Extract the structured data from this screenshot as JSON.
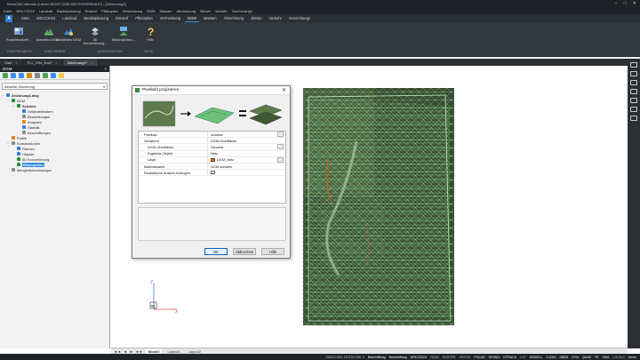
{
  "window": {
    "title": "BricsCAD Ultimate (Lizenz NICHT ZUM WEITERVERKAUF) - [Zeichnung1]",
    "controls": [
      "–",
      "□",
      "✕"
    ]
  },
  "menu": [
    "Datei",
    "WSLC2024",
    "Landcad",
    "Bauleitplanung",
    "Entwurf",
    "Pflanzplan",
    "Vermessung",
    "DGM",
    "Massen",
    "Abrechnung",
    "3Drain",
    "Verkehr",
    "GeoXchange"
  ],
  "ribbon": {
    "logo": "A",
    "tabs": [
      {
        "label": "Start",
        "active": false
      },
      {
        "label": "WSLC2024",
        "active": false
      },
      {
        "label": "Landcad",
        "active": false
      },
      {
        "label": "Bauleitplanung",
        "active": false
      },
      {
        "label": "Entwurf",
        "active": false
      },
      {
        "label": "Pflanzplan",
        "active": false
      },
      {
        "label": "Vermessung",
        "active": false
      },
      {
        "label": "DGM",
        "active": true
      },
      {
        "label": "Massen",
        "active": false
      },
      {
        "label": "Abrechnung",
        "active": false
      },
      {
        "label": "3Drain",
        "active": false
      },
      {
        "label": "Verkehr",
        "active": false
      },
      {
        "label": "GeoXchange",
        "active": false
      }
    ],
    "buttons": [
      {
        "label": "Projektexplorer..."
      },
      {
        "label": "Aktuelles DGM..."
      },
      {
        "label": "Gewähltes DGM"
      },
      {
        "label": "3D Konvertierung..."
      },
      {
        "label": "Bildprojektion..."
      },
      {
        "label": "Hilfe"
      }
    ],
    "groups": [
      "DGM-PROJEKTE",
      "DGM-VIEWER",
      "KONSTRUKTION",
      "HILFE"
    ]
  },
  "doc_tabs": [
    {
      "label": "Start",
      "active": false
    },
    {
      "label": "FLL_DIM_final*",
      "active": false
    },
    {
      "label": "Zeichnung1*",
      "active": true
    }
  ],
  "panel": {
    "title": "DGM",
    "select_value": "Aktuelle Zeichnung",
    "tree": [
      {
        "level": 0,
        "label": "Zeichnung1.dwg",
        "bold": true,
        "expand": "−",
        "icon": "#3a7bd5"
      },
      {
        "level": 1,
        "label": "DGM",
        "bold": false,
        "expand": "−",
        "icon": "#2b8a3e"
      },
      {
        "level": 2,
        "label": "Schweiz",
        "bold": true,
        "expand": "−",
        "icon": "#2b8a3e"
      },
      {
        "level": 3,
        "label": "Geländefenstern",
        "bold": false,
        "expand": "",
        "icon": "#3a7bd5"
      },
      {
        "level": 3,
        "label": "Bearbeitungen",
        "bold": false,
        "expand": "",
        "icon": "#888888"
      },
      {
        "level": 3,
        "label": "Analysen",
        "bold": false,
        "expand": "",
        "icon": "#d18b1a"
      },
      {
        "level": 3,
        "label": "Statistik",
        "bold": false,
        "expand": "",
        "icon": "#3a7bd5"
      },
      {
        "level": 3,
        "label": "Beschriftungen",
        "bold": false,
        "expand": "",
        "icon": "#888888"
      },
      {
        "level": 1,
        "label": "Profile",
        "bold": false,
        "expand": "",
        "icon": "#d18b1a"
      },
      {
        "level": 1,
        "label": "Konstruktionen",
        "bold": false,
        "expand": "−",
        "icon": "#888888"
      },
      {
        "level": 2,
        "label": "Flächen",
        "bold": false,
        "expand": "",
        "icon": "#3a7bd5"
      },
      {
        "level": 2,
        "label": "Objekte",
        "bold": false,
        "expand": "",
        "icon": "#3a7bd5"
      },
      {
        "level": 2,
        "label": "3D Konvertierung",
        "bold": false,
        "expand": "",
        "icon": "#2b8a3e"
      },
      {
        "level": 2,
        "label": "Bildprojektion",
        "bold": false,
        "expand": "",
        "icon": "#2b8a3e",
        "selected": true
      },
      {
        "level": 1,
        "label": "Mengenberechnungen",
        "bold": false,
        "expand": "",
        "icon": "#888888"
      }
    ]
  },
  "dialog": {
    "title": "Pixelbild projizieren",
    "close": "✕",
    "properties": [
      {
        "key": "Pixelbild",
        "value": "schweiz",
        "sub": false,
        "type": "text",
        "browse": true
      },
      {
        "key": "Verfahren",
        "value": "DGM-Oberfläche",
        "sub": false,
        "type": "text",
        "browse": false
      },
      {
        "key": "DGM-Oberfläche",
        "value": "Schweiz",
        "sub": true,
        "type": "text",
        "browse": true
      },
      {
        "key": "Ergebnis-Objekt",
        "value": "Netz",
        "sub": true,
        "type": "text",
        "browse": false
      },
      {
        "key": "Layer",
        "value": "DGM_Netz",
        "sub": true,
        "type": "layer",
        "browse": true
      },
      {
        "key": "Materialname",
        "value": "DGM-schweiz",
        "sub": false,
        "type": "text",
        "browse": false
      },
      {
        "key": "Realistische Ansicht erzeugen",
        "value": "✓",
        "sub": false,
        "type": "check",
        "browse": false
      }
    ],
    "buttons": {
      "ok": "OK",
      "cancel": "Abbrechen",
      "help": "Hilfe"
    }
  },
  "layout_tabs": {
    "nav": [
      "◄◄",
      "◄",
      "►",
      "►►"
    ],
    "tabs": [
      {
        "label": "Modell",
        "active": true
      },
      {
        "label": "Layout1",
        "active": false
      },
      {
        "label": "Layout2",
        "active": false
      }
    ]
  },
  "ucs": {
    "x": "X",
    "y": "Y",
    "w": "W"
  },
  "status": {
    "coords": "758424.905, 167234.995, 0",
    "items": [
      {
        "label": "Beschriftung",
        "on": true
      },
      {
        "label": "Beschriftung",
        "on": true
      },
      {
        "label": "WSLC2024",
        "on": true
      },
      {
        "label": "FANG",
        "on": false
      },
      {
        "label": "RASTER",
        "on": false
      },
      {
        "label": "ORTHO",
        "on": false
      },
      {
        "label": "POLAR",
        "on": true
      },
      {
        "label": "OFANG",
        "on": true
      },
      {
        "label": "OTRACK",
        "on": true
      },
      {
        "label": "LST",
        "on": false
      },
      {
        "label": "MODELL",
        "on": true
      },
      {
        "label": "1:1000",
        "on": true
      },
      {
        "label": "DBES",
        "on": true
      },
      {
        "label": "DYN",
        "on": true
      },
      {
        "label": "QUAD",
        "on": true
      },
      {
        "label": "RT",
        "on": true
      },
      {
        "label": "HKA",
        "on": true
      },
      {
        "label": "LOCKUI",
        "on": false
      },
      {
        "label": "Keine",
        "on": true
      }
    ]
  }
}
